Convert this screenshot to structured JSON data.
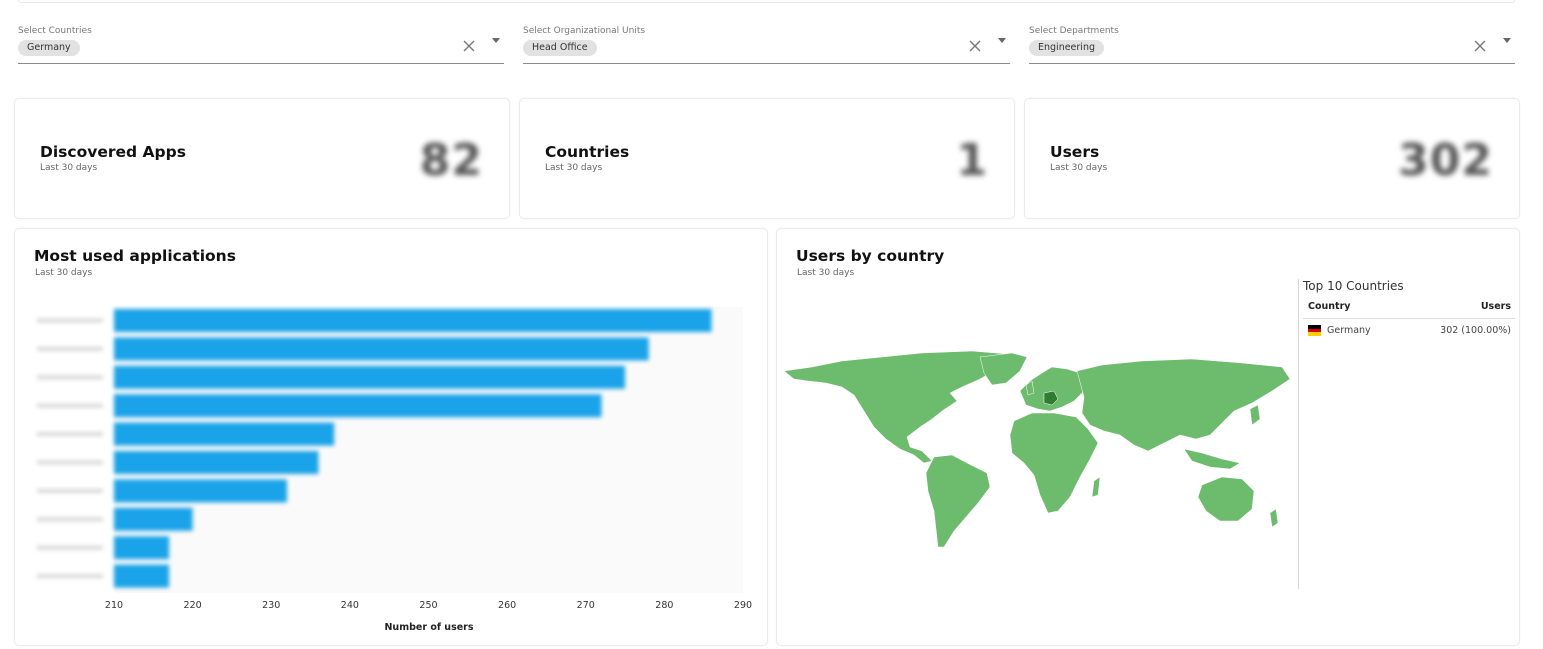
{
  "filters": [
    {
      "label": "Select Countries",
      "chip": "Germany"
    },
    {
      "label": "Select Organizational Units",
      "chip": "Head Office"
    },
    {
      "label": "Select Departments",
      "chip": "Engineering"
    }
  ],
  "stats": [
    {
      "title": "Discovered Apps",
      "subtitle": "Last 30 days",
      "value": "82"
    },
    {
      "title": "Countries",
      "subtitle": "Last 30 days",
      "value": "1"
    },
    {
      "title": "Users",
      "subtitle": "Last 30 days",
      "value": "302"
    }
  ],
  "most_used": {
    "title": "Most used applications",
    "subtitle": "Last 30 days"
  },
  "users_by_country": {
    "title": "Users by country",
    "subtitle": "Last 30 days",
    "table_title": "Top 10 Countries",
    "col_country": "Country",
    "col_users": "Users",
    "rows": [
      {
        "country": "Germany",
        "users": "302 (100.00%)"
      }
    ],
    "map_land_color": "#6dbb6d",
    "highlight_color": "#2e7d32"
  },
  "chart_data": {
    "type": "bar",
    "orientation": "horizontal",
    "categories": [
      "",
      "",
      "",
      "",
      "",
      "",
      "",
      "",
      "",
      ""
    ],
    "values": [
      286,
      278,
      275,
      272,
      238,
      236,
      232,
      220,
      217,
      217
    ],
    "xlabel": "Number of users",
    "xlim": [
      210,
      290
    ],
    "xticks": [
      210,
      220,
      230,
      240,
      250,
      260,
      270,
      280,
      290
    ],
    "bar_color": "#1aa3e8"
  }
}
